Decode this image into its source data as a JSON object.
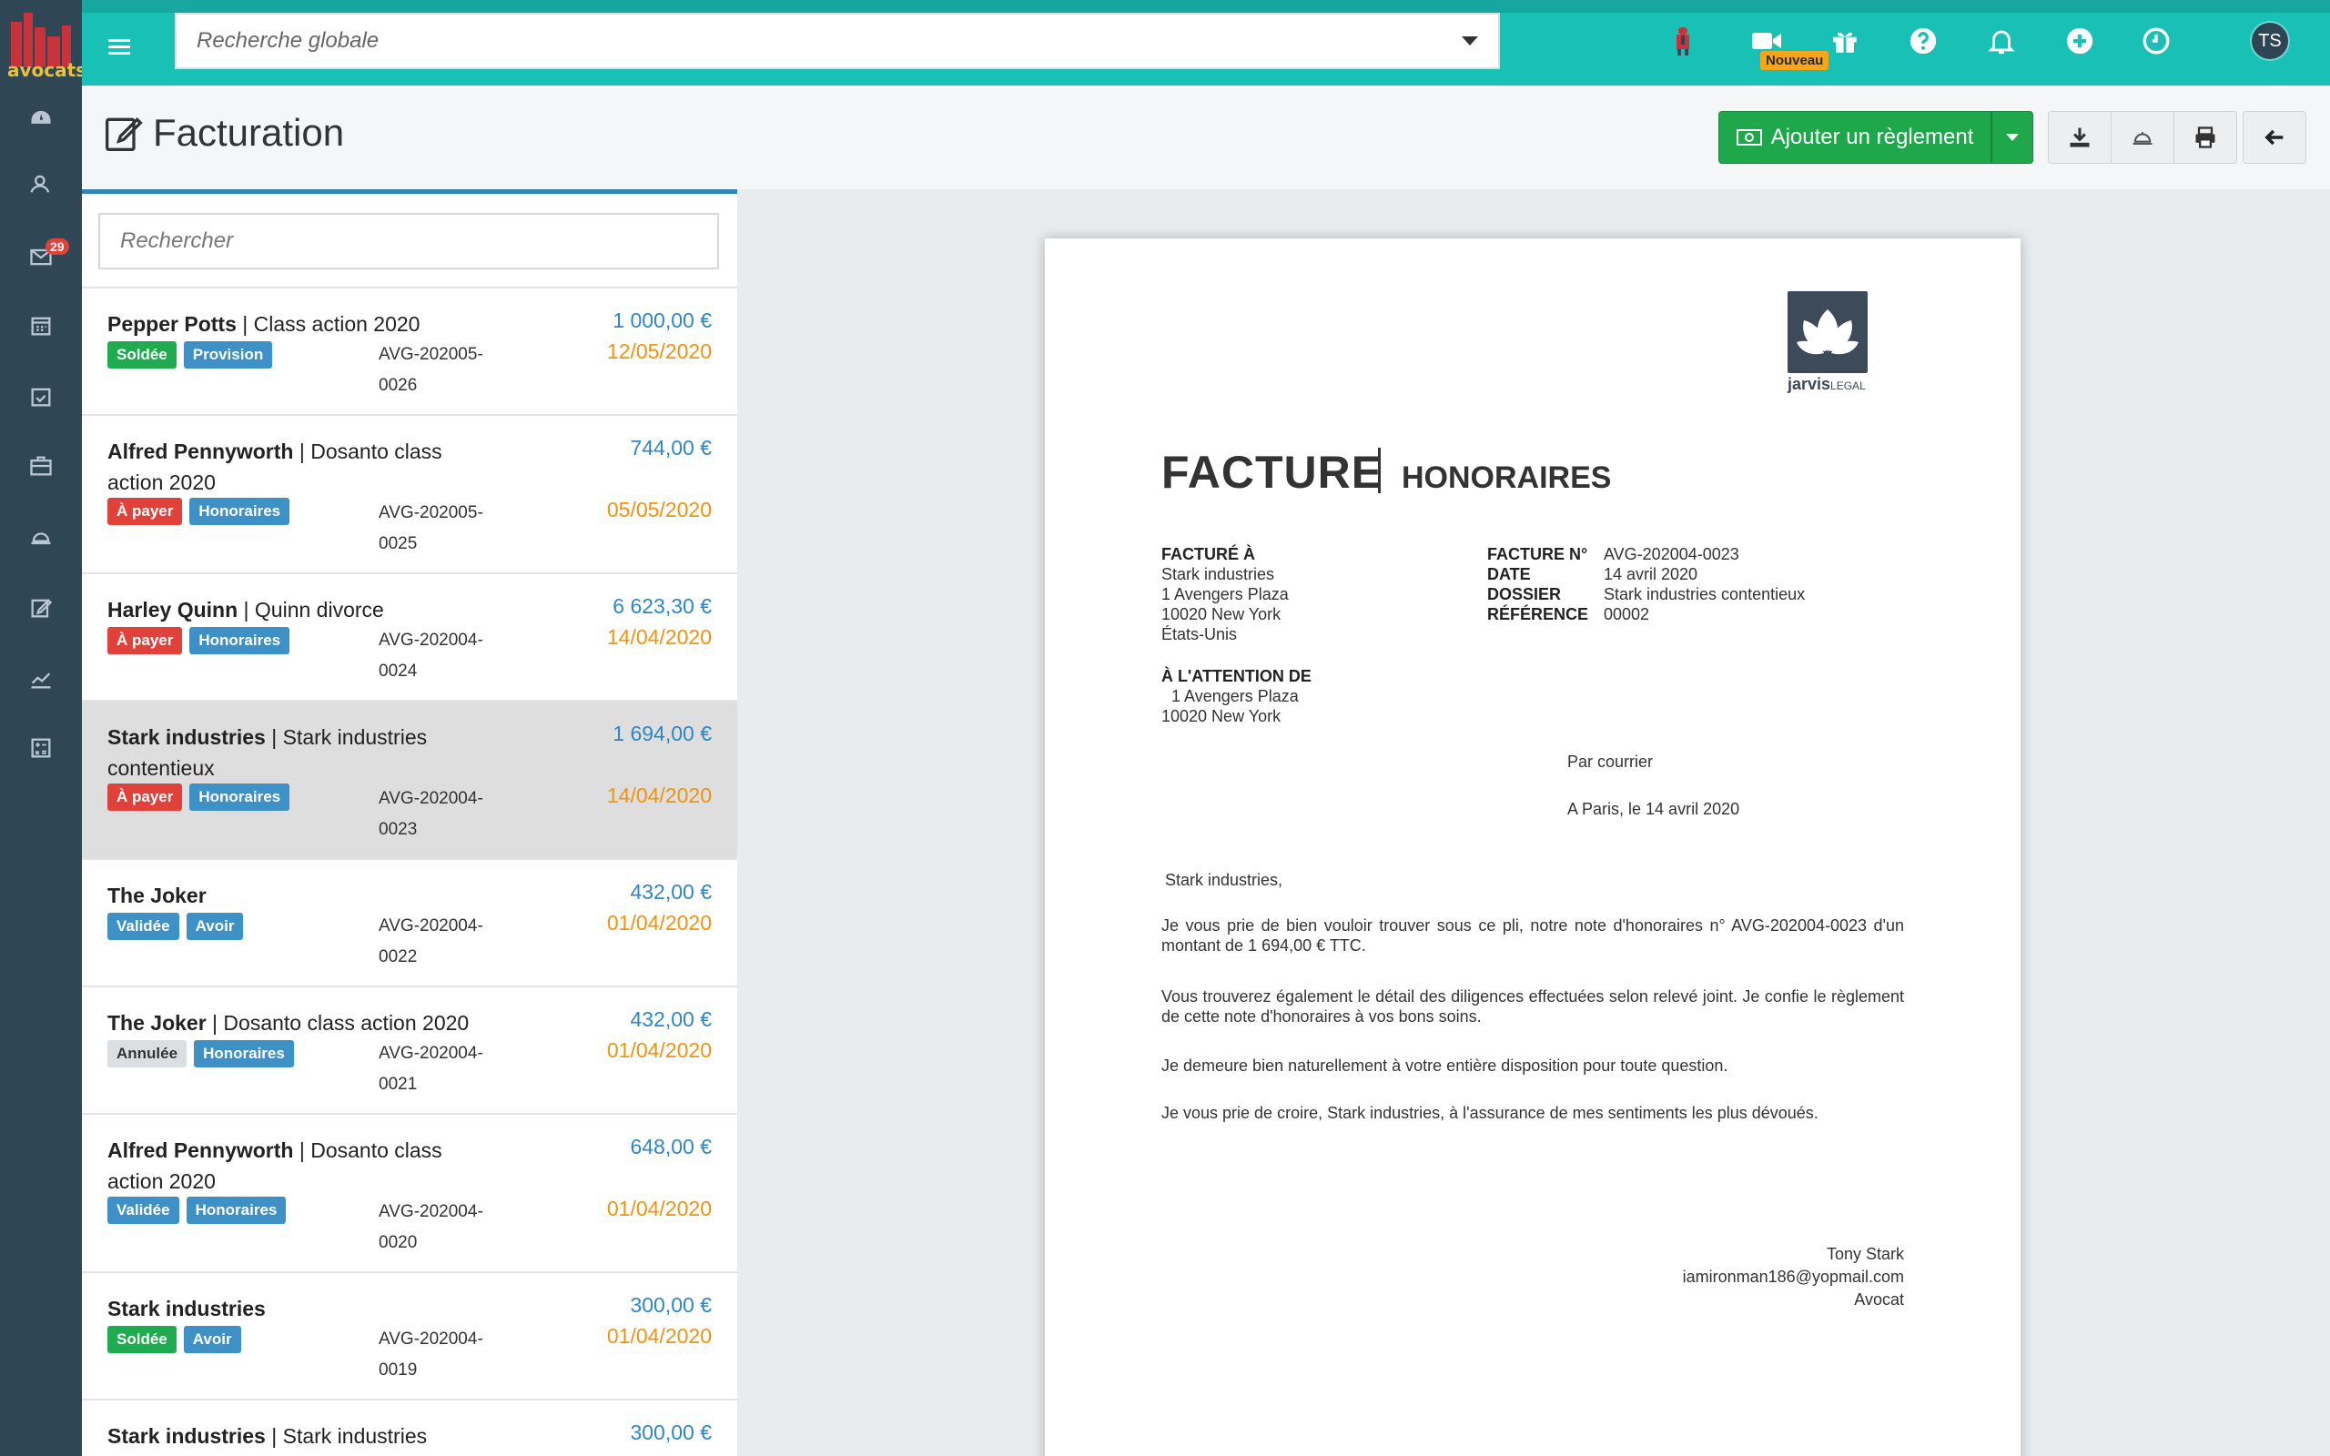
{
  "app": {
    "logo_text": "avocats"
  },
  "topbar": {
    "search_placeholder": "Recherche globale",
    "nouveau_badge": "Nouveau",
    "avatar_initials": "TS"
  },
  "sidebar": {
    "mail_badge": "29"
  },
  "header": {
    "title": "Facturation",
    "add_payment_label": "Ajouter un règlement"
  },
  "list": {
    "search_placeholder": "Rechercher",
    "items": [
      {
        "name": "Pepper Potts",
        "subject": " | Class action 2020",
        "amount": "1 000,00 €",
        "date": "12/05/2020",
        "tags": [
          "Soldée",
          "Provision"
        ],
        "ref": "AVG-202005-0026"
      },
      {
        "name": "Alfred Pennyworth",
        "subject": " | Dosanto class action 2020",
        "amount": "744,00 €",
        "date": "05/05/2020",
        "tags": [
          "À payer",
          "Honoraires"
        ],
        "ref": "AVG-202005-0025"
      },
      {
        "name": "Harley Quinn",
        "subject": " | Quinn divorce",
        "amount": "6 623,30 €",
        "date": "14/04/2020",
        "tags": [
          "À payer",
          "Honoraires"
        ],
        "ref": "AVG-202004-0024"
      },
      {
        "name": "Stark industries",
        "subject": " | Stark industries contentieux",
        "amount": "1 694,00 €",
        "date": "14/04/2020",
        "tags": [
          "À payer",
          "Honoraires"
        ],
        "ref": "AVG-202004-0023"
      },
      {
        "name": "The Joker",
        "subject": "",
        "amount": "432,00 €",
        "date": "01/04/2020",
        "tags": [
          "Validée",
          "Avoir"
        ],
        "ref": "AVG-202004-0022"
      },
      {
        "name": "The Joker",
        "subject": " | Dosanto class action 2020",
        "amount": "432,00 €",
        "date": "01/04/2020",
        "tags": [
          "Annulée",
          "Honoraires"
        ],
        "ref": "AVG-202004-0021"
      },
      {
        "name": "Alfred Pennyworth",
        "subject": " | Dosanto class action 2020",
        "amount": "648,00 €",
        "date": "01/04/2020",
        "tags": [
          "Validée",
          "Honoraires"
        ],
        "ref": "AVG-202004-0020"
      },
      {
        "name": "Stark industries",
        "subject": "",
        "amount": "300,00 €",
        "date": "01/04/2020",
        "tags": [
          "Soldée",
          "Avoir"
        ],
        "ref": "AVG-202004-0019"
      },
      {
        "name": "Stark industries",
        "subject": " | Stark industries contentieux",
        "amount": "300,00 €",
        "date": "",
        "tags": [],
        "ref": ""
      }
    ]
  },
  "doc": {
    "logo_brand": "jarvis",
    "logo_suffix": "LEGAL",
    "title": "FACTURE",
    "subtitle": "HONORAIRES",
    "billed_to_label": "FACTURÉ À",
    "billed_to_lines": [
      "Stark industries",
      "1 Avengers Plaza",
      "10020 New York",
      "États-Unis"
    ],
    "invoice_no_label": "FACTURE N°",
    "invoice_no": "AVG-202004-0023",
    "date_label": "DATE",
    "date": "14 avril 2020",
    "dossier_label": "DOSSIER",
    "dossier": "Stark industries contentieux",
    "reference_label": "RÉFÉRENCE",
    "reference": "00002",
    "attention_label": "À L'ATTENTION DE",
    "attention_lines": [
      "1 Avengers Plaza",
      "10020 New York"
    ],
    "by_mail": "Par courrier",
    "place_date": "A Paris, le 14 avril 2020",
    "greeting": "Stark industries,",
    "para1": "Je vous prie de bien vouloir trouver sous ce pli, notre note d'honoraires n° AVG-202004-0023 d'un montant de 1 694,00 € TTC.",
    "para2": "Vous trouverez également le détail des diligences effectuées selon relevé joint. Je confie le règlement de cette note d'honoraires à vos bons soins.",
    "para3": "Je demeure bien naturellement à votre entière disposition pour toute question.",
    "para4": "Je vous prie de croire,  Stark industries, à l'assurance de mes sentiments les plus dévoués.",
    "signer_name": "Tony Stark",
    "signer_email": "iamironman186@yopmail.com",
    "signer_role": "Avocat"
  },
  "colors": {
    "topbar": "#19c0b6",
    "sidebar": "#2f4655",
    "accent_blue": "#2f86c4",
    "date_orange": "#f0940f",
    "green": "#1ea84b",
    "red": "#e0413a"
  }
}
